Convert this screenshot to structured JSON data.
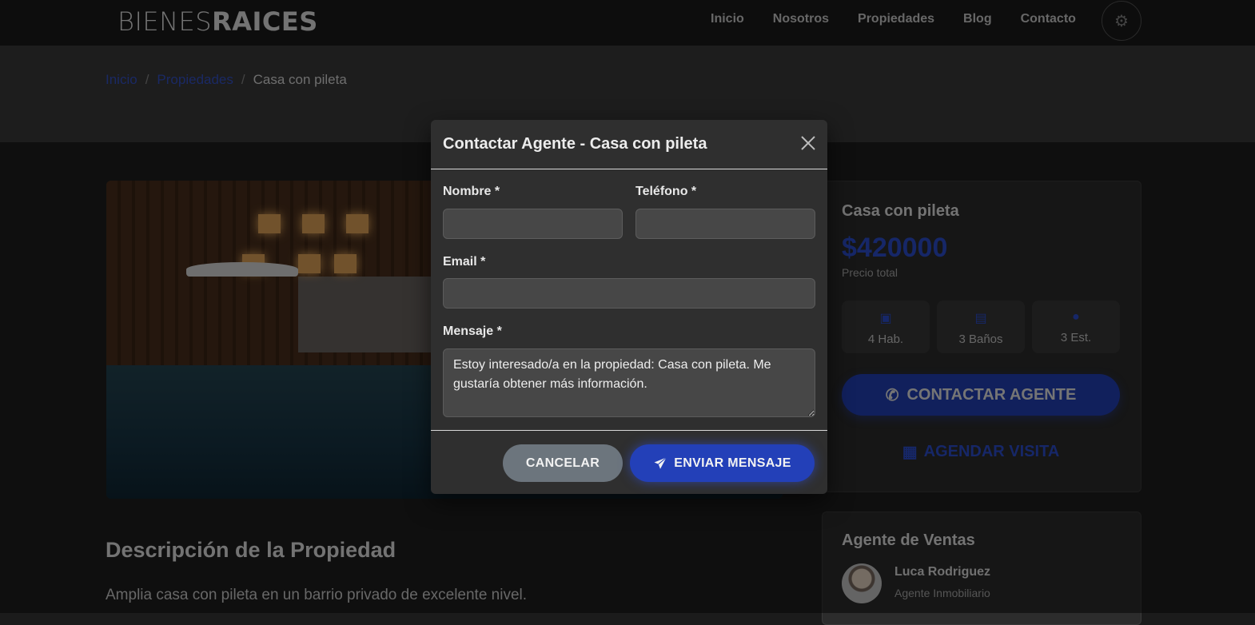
{
  "navbar": {
    "brand_light": "BIENES",
    "brand_bold": "RAICES",
    "links": [
      "Inicio",
      "Nosotros",
      "Propiedades",
      "Blog",
      "Contacto"
    ],
    "theme_icon": "gear-icon"
  },
  "breadcrumb": {
    "items": [
      "Inicio",
      "Propiedades"
    ],
    "separator": "/",
    "current": "Casa con pileta"
  },
  "property": {
    "title": "Casa con pileta",
    "price": "$420000",
    "price_note": "Precio total",
    "features": [
      {
        "icon": "bed-icon",
        "label": "4 Hab."
      },
      {
        "icon": "bath-icon",
        "label": "3 Baños"
      },
      {
        "icon": "car-icon",
        "label": "3 Est."
      }
    ],
    "contact_button": "CONTACTAR AGENTE",
    "visit_button": "AGENDAR VISITA",
    "description_title": "Descripción de la Propiedad",
    "description_text": "Amplia casa con pileta en un barrio privado de excelente nivel."
  },
  "agent": {
    "section_title": "Agente de Ventas",
    "name": "Luca Rodriguez",
    "role": "Agente Inmobiliario"
  },
  "modal": {
    "title": "Contactar Agente - Casa con pileta",
    "fields": {
      "name_label": "Nombre *",
      "name_value": "",
      "phone_label": "Teléfono *",
      "phone_value": "",
      "email_label": "Email *",
      "email_value": "",
      "message_label": "Mensaje *",
      "message_value": "Estoy interesado/a en la propiedad: Casa con pileta. Me gustaría obtener más información."
    },
    "cancel_button": "CANCELAR",
    "send_button": "ENVIAR MENSAJE"
  },
  "colors": {
    "accent": "#2340b8",
    "price": "#2c4fd0",
    "cancel": "#6c757d",
    "modal_bg": "#2f2f2f"
  }
}
